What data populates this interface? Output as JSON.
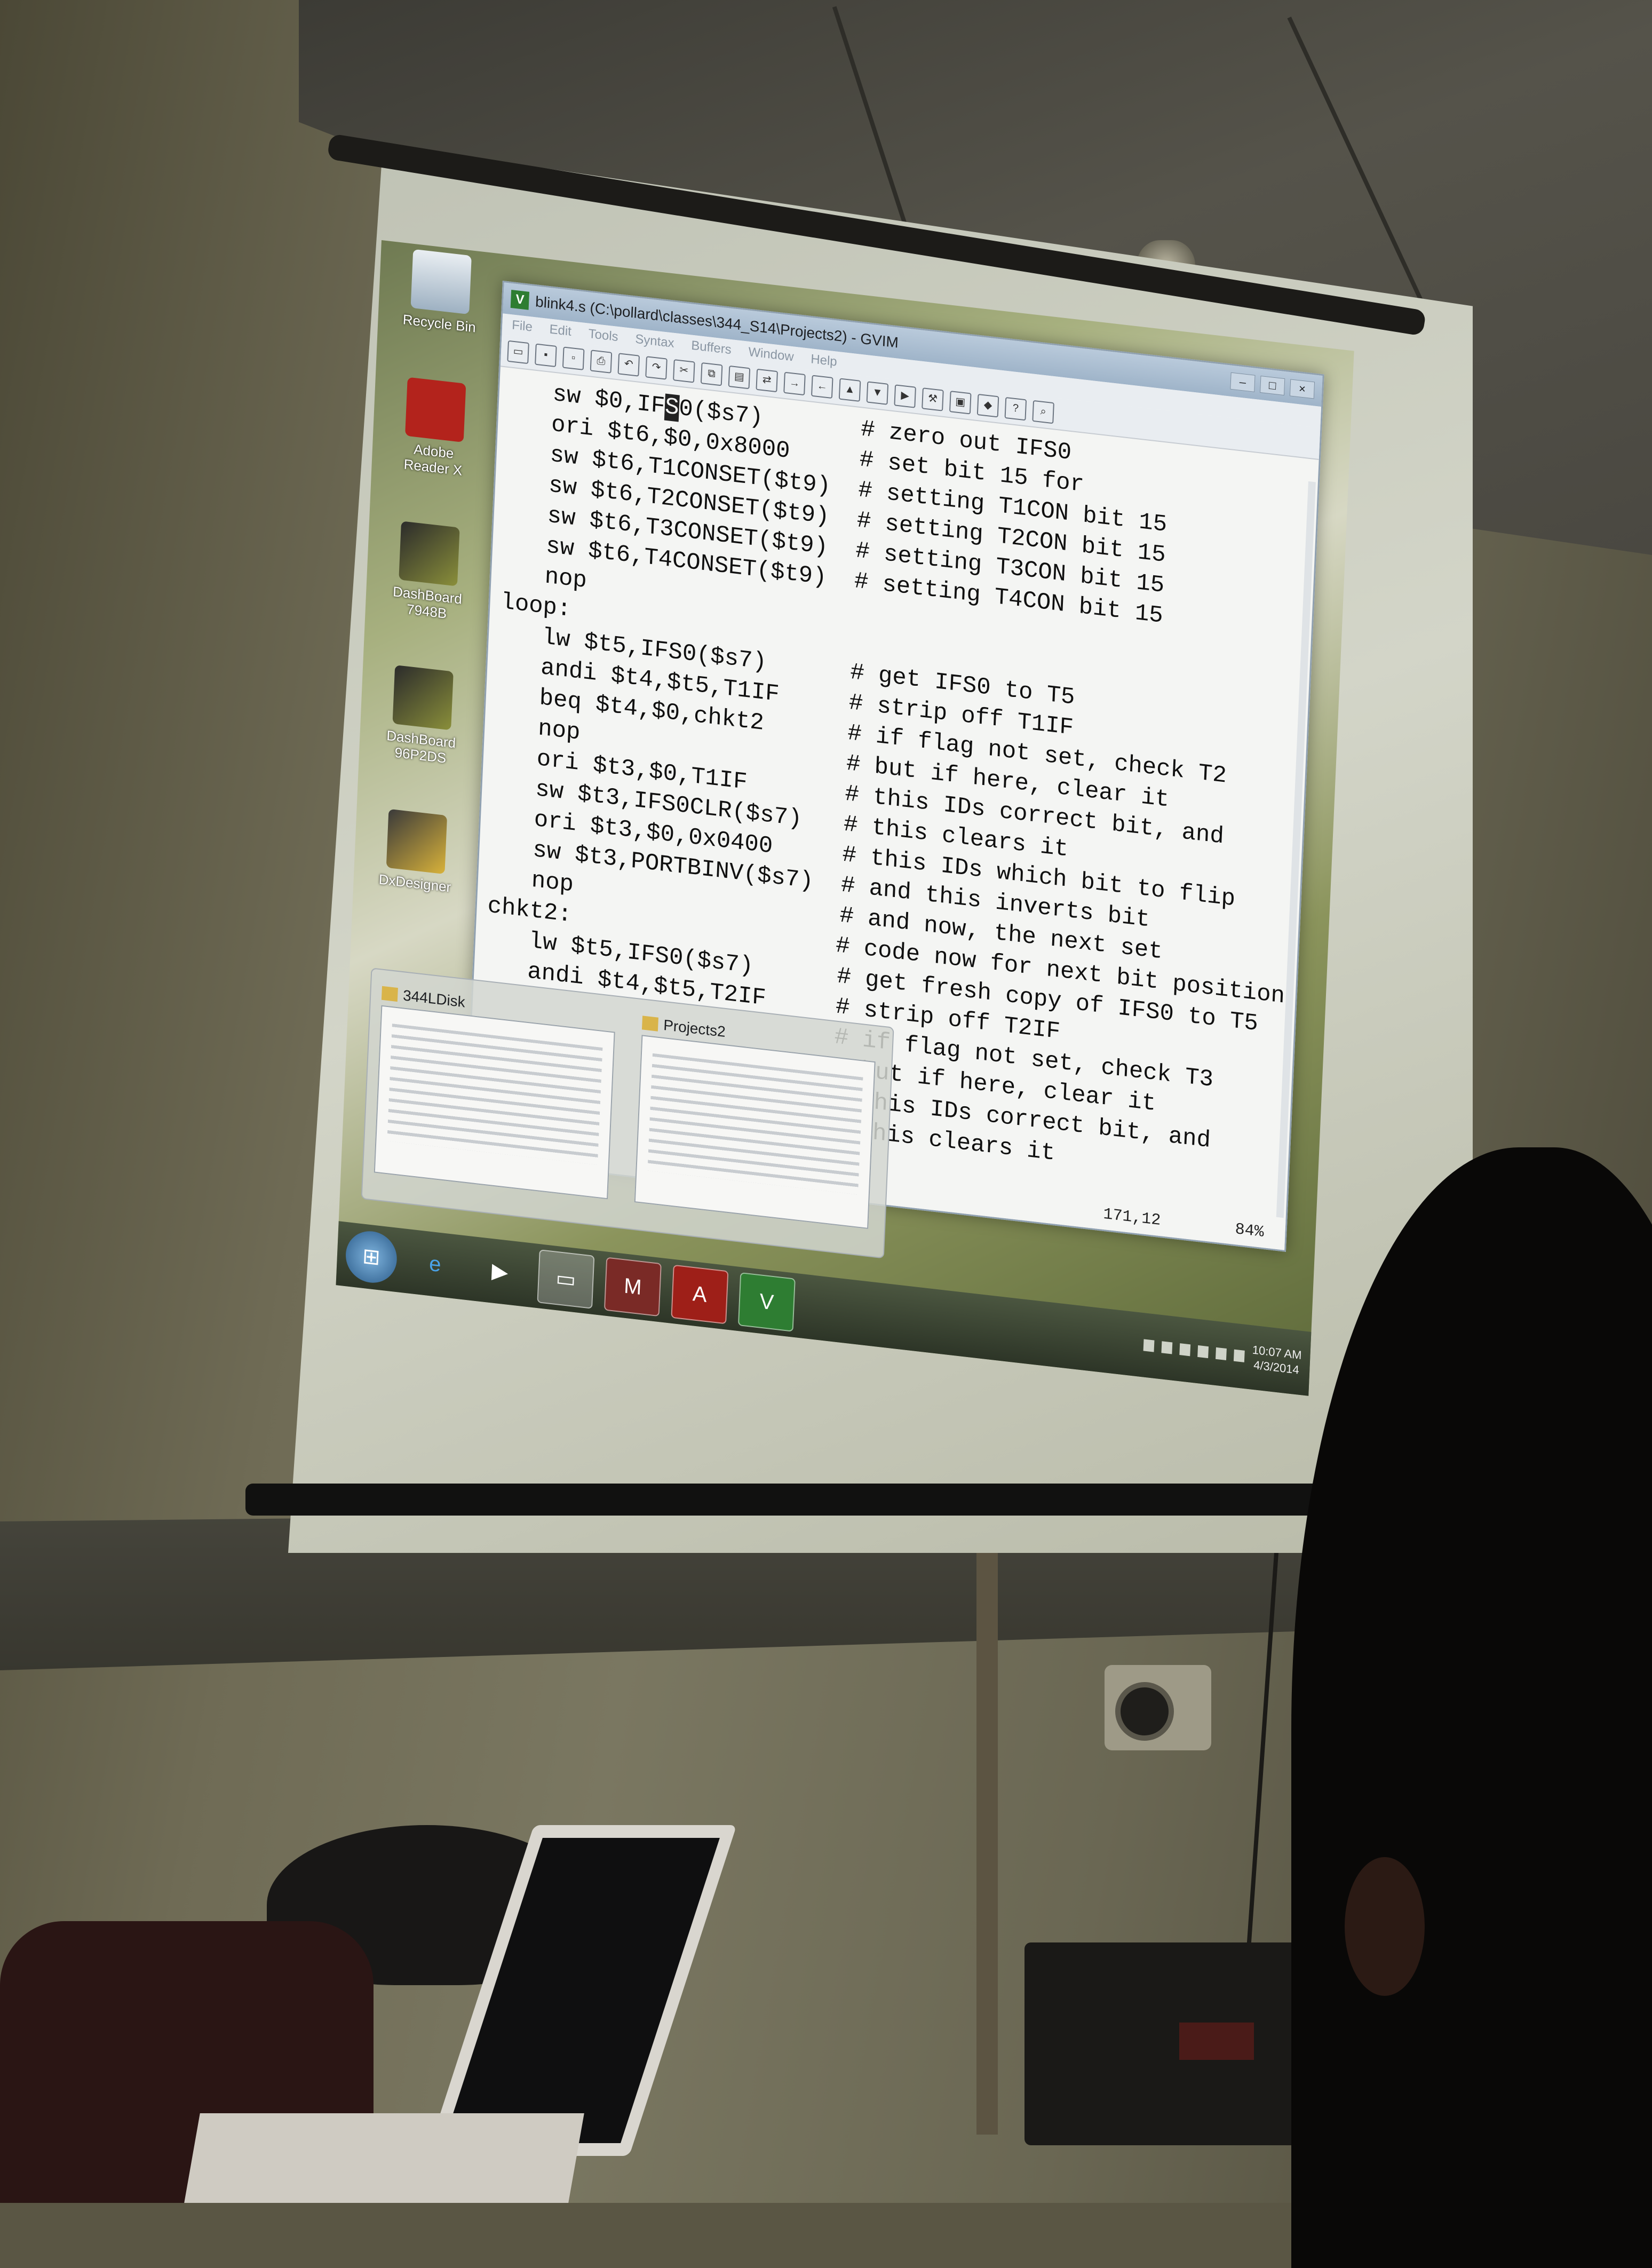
{
  "window": {
    "title": "blink4.s (C:\\pollard\\classes\\344_S14\\Projects2) - GVIM",
    "controls": [
      "–",
      "□",
      "×"
    ]
  },
  "menu": [
    "File",
    "Edit",
    "Tools",
    "Syntax",
    "Buffers",
    "Window",
    "Help"
  ],
  "toolbar_icons": [
    "open-icon",
    "save-icon",
    "save-all-icon",
    "print-icon",
    "undo-icon",
    "redo-icon",
    "cut-icon",
    "copy-icon",
    "paste-icon",
    "replace-icon",
    "find-next-icon",
    "find-prev-icon",
    "load-session-icon",
    "save-session-icon",
    "run-script-icon",
    "make-icon",
    "shell-icon",
    "tags-icon",
    "help-icon",
    "find-help-icon"
  ],
  "code": [
    {
      "instr": "sw $0,IFS0($s7)",
      "indent": true,
      "cmt": "# zero out IFS0"
    },
    {
      "instr": "ori $t6,$0,0x8000",
      "indent": true,
      "cmt": "# set bit 15 for"
    },
    {
      "instr": "sw $t6,T1CONSET($t9)",
      "indent": true,
      "cmt": "# setting T1CON bit 15"
    },
    {
      "instr": "sw $t6,T2CONSET($t9)",
      "indent": true,
      "cmt": "# setting T2CON bit 15"
    },
    {
      "instr": "sw $t6,T3CONSET($t9)",
      "indent": true,
      "cmt": "# setting T3CON bit 15"
    },
    {
      "instr": "sw $t6,T4CONSET($t9)",
      "indent": true,
      "cmt": "# setting T4CON bit 15"
    },
    {
      "instr": "nop",
      "indent": true,
      "cmt": ""
    },
    {
      "instr": "loop:",
      "indent": false,
      "cmt": ""
    },
    {
      "instr": "lw $t5,IFS0($s7)",
      "indent": true,
      "cmt": "# get IFS0 to T5"
    },
    {
      "instr": "andi $t4,$t5,T1IF",
      "indent": true,
      "cmt": "# strip off T1IF"
    },
    {
      "instr": "beq $t4,$0,chkt2",
      "indent": true,
      "cmt": "# if flag not set, check T2"
    },
    {
      "instr": "nop",
      "indent": true,
      "cmt": "# but if here, clear it"
    },
    {
      "instr": "ori $t3,$0,T1IF",
      "indent": true,
      "cmt": "# this IDs correct bit, and"
    },
    {
      "instr": "sw $t3,IFS0CLR($s7)",
      "indent": true,
      "cmt": "# this clears it"
    },
    {
      "instr": "ori $t3,$0,0x0400",
      "indent": true,
      "cmt": "# this IDs which bit to flip"
    },
    {
      "instr": "sw $t3,PORTBINV($s7)",
      "indent": true,
      "cmt": "# and this inverts bit"
    },
    {
      "instr": "nop",
      "indent": true,
      "cmt": "# and now, the next set"
    },
    {
      "instr": "chkt2:",
      "indent": false,
      "cmt": "# code now for next bit position"
    },
    {
      "instr": "lw $t5,IFS0($s7)",
      "indent": true,
      "cmt": "# get fresh copy of IFS0 to T5"
    },
    {
      "instr": "andi $t4,$t5,T2IF",
      "indent": true,
      "cmt": "# strip off T2IF"
    },
    {
      "instr": "",
      "indent": true,
      "cmt": "# if flag not set, check T3"
    },
    {
      "instr": "",
      "indent": true,
      "cmt": "# but if here, clear it"
    },
    {
      "instr": "",
      "indent": true,
      "cmt": "# this IDs correct bit, and"
    },
    {
      "instr": "",
      "indent": true,
      "cmt": "# this clears it"
    }
  ],
  "status": {
    "position": "171,12",
    "percent": "84%"
  },
  "desktop_icons": [
    {
      "label": "Recycle Bin",
      "icon": "recycle-bin-icon"
    },
    {
      "label": "Adobe Reader X",
      "icon": "adobe-reader-icon"
    },
    {
      "label": "DashBoard 7948B",
      "icon": "dashboard-icon"
    },
    {
      "label": "DashBoard 96P2DS",
      "icon": "dashboard-icon"
    },
    {
      "label": "DxDesigner",
      "icon": "dxdesigner-icon"
    }
  ],
  "taskbar_preview": [
    {
      "title": "344LDisk"
    },
    {
      "title": "Projects2"
    }
  ],
  "taskbar": {
    "pinned": [
      "windows-start-icon",
      "internet-explorer-icon",
      "media-player-icon",
      "explorer-icon",
      "mplab-icon",
      "acrobat-icon",
      "gvim-icon"
    ],
    "time": "10:07 AM",
    "date": "4/3/2014"
  },
  "colors": {
    "editor_bg": "#f4f5f3",
    "titlebar": "#9fb4c9",
    "taskbar": "#2d3527"
  }
}
